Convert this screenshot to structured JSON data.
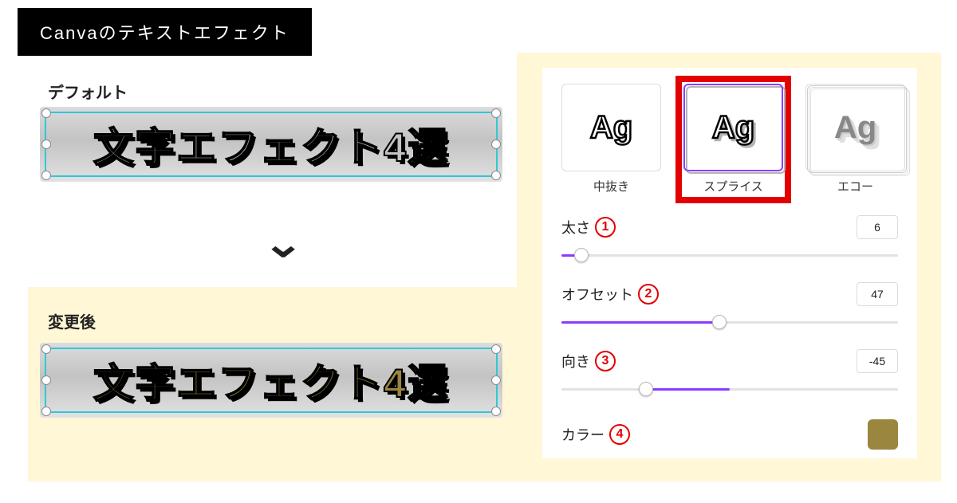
{
  "header": {
    "title": "Canvaのテキストエフェクト"
  },
  "left": {
    "default_label": "デフォルト",
    "after_label": "変更後",
    "sample_text": "文字エフェクト4選"
  },
  "panel": {
    "effects": {
      "hollow": {
        "preview": "Ag",
        "label": "中抜き"
      },
      "splice": {
        "preview": "Ag",
        "label": "スプライス"
      },
      "echo": {
        "preview": "Ag",
        "label": "エコー"
      }
    },
    "controls": {
      "thickness": {
        "label": "太さ",
        "badge": "1",
        "value": "6",
        "pct": 6
      },
      "offset": {
        "label": "オフセット",
        "badge": "2",
        "value": "47",
        "pct": 47
      },
      "direction": {
        "label": "向き",
        "badge": "3",
        "value": "-45",
        "from_center_pct": -25
      },
      "color": {
        "label": "カラー",
        "badge": "4",
        "hex": "#9b8640"
      }
    }
  }
}
